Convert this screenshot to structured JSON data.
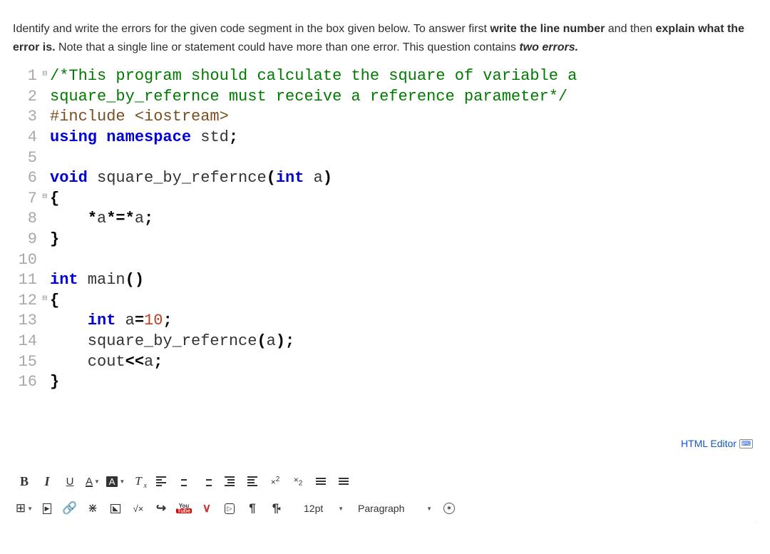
{
  "question": {
    "p1a": "Identify and write the errors for the given code segment in the box given below. To answer first ",
    "p1b": "write the line number",
    "p1c": " and then ",
    "p1d": "explain what the error is.",
    "p1e": "  Note that a single line or statement could have more than one error. This question contains ",
    "p1f": "two errors."
  },
  "code": {
    "lines": [
      {
        "n": "1",
        "fold": "⊟",
        "html": "<span class='tok-comment'>/*This program should calculate the square of variable a</span>"
      },
      {
        "n": "2",
        "fold": "└",
        "html": "<span class='tok-comment'>square_by_refernce must receive a reference parameter*/</span>"
      },
      {
        "n": "3",
        "html": "<span class='tok-pre'>#include &lt;iostream&gt;</span>"
      },
      {
        "n": "4",
        "html": "<span class='tok-keyword'>using</span> <span class='tok-keyword'>namespace</span> std<span class='tok-op'>;</span>"
      },
      {
        "n": "5",
        "html": ""
      },
      {
        "n": "6",
        "html": "<span class='tok-keyword'>void</span> square_by_refernce<span class='tok-op'>(</span><span class='tok-keyword'>int</span> a<span class='tok-op'>)</span>"
      },
      {
        "n": "7",
        "fold": "⊟",
        "html": "<span class='tok-op'>{</span>"
      },
      {
        "n": "8",
        "html": "    <span class='tok-op'>*</span>a<span class='tok-op'>*=*</span>a<span class='tok-op'>;</span>"
      },
      {
        "n": "9",
        "fold": "└",
        "html": "<span class='tok-op'>}</span>"
      },
      {
        "n": "10",
        "html": ""
      },
      {
        "n": "11",
        "html": "<span class='tok-keyword'>int</span> main<span class='tok-op'>()</span>"
      },
      {
        "n": "12",
        "fold": "⊟",
        "html": "<span class='tok-op'>{</span>"
      },
      {
        "n": "13",
        "html": "    <span class='tok-keyword'>int</span> a<span class='tok-op'>=</span><span class='tok-num'>10</span><span class='tok-op'>;</span>"
      },
      {
        "n": "14",
        "html": "    square_by_refernce<span class='tok-op'>(</span>a<span class='tok-op'>);</span>"
      },
      {
        "n": "15",
        "html": "    cout<span class='tok-op'>&lt;&lt;</span>a<span class='tok-op'>;</span>"
      },
      {
        "n": "16",
        "fold": "└",
        "html": "<span class='tok-op'>}</span>"
      }
    ]
  },
  "editor": {
    "label": "HTML Editor",
    "font_size": "12pt",
    "paragraph": "Paragraph",
    "bold": "B",
    "italic": "I",
    "underline": "U",
    "textcolor": "A",
    "bgcolor": "A",
    "clearfmt": "T",
    "clearfmt_x": "x",
    "sup": "×",
    "sup2": "2",
    "sub": "×",
    "sub2": "2",
    "sqrt": "√×",
    "arrow": "↪",
    "pilcrow": "¶",
    "pilcrow_r": "¶",
    "vee": "∨"
  }
}
